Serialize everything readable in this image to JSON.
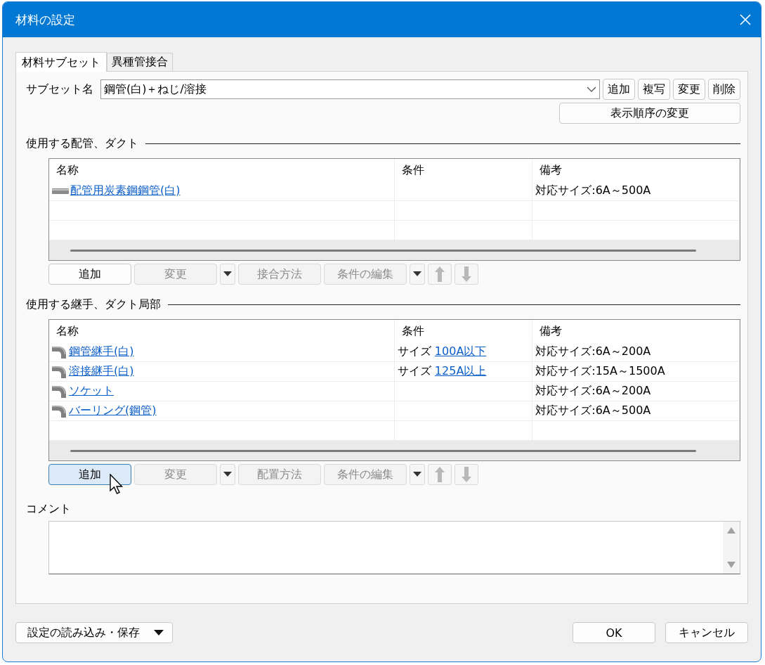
{
  "window": {
    "title": "材料の設定"
  },
  "tabs": [
    {
      "label": "材料サブセット",
      "selected": true
    },
    {
      "label": "異種管接合",
      "selected": false
    }
  ],
  "subset": {
    "label": "サブセット名",
    "value": "鋼管(白)＋ねじ/溶接",
    "buttons": [
      "追加",
      "複写",
      "変更",
      "削除"
    ],
    "order_button": "表示順序の変更"
  },
  "sections": [
    {
      "title": "使用する配管、ダクト",
      "columns": [
        "名称",
        "条件",
        "備考"
      ],
      "rows": [
        {
          "kind": "pipe",
          "name": "配管用炭素鋼鋼管(白)",
          "note": "対応サイズ:6A～500A"
        }
      ],
      "toolbar": [
        {
          "kind": "button",
          "label": "追加",
          "disabled": false,
          "hovered": false
        },
        {
          "kind": "button",
          "label": "変更",
          "disabled": true,
          "hovered": false
        },
        {
          "kind": "caret",
          "disabled": false
        },
        {
          "kind": "button",
          "label": "接合方法",
          "disabled": true,
          "hovered": false
        },
        {
          "kind": "button",
          "label": "条件の編集",
          "disabled": true,
          "hovered": false
        },
        {
          "kind": "caret",
          "disabled": false
        },
        {
          "kind": "up",
          "disabled": true
        },
        {
          "kind": "down",
          "disabled": true
        }
      ]
    },
    {
      "title": "使用する継手、ダクト局部",
      "columns": [
        "名称",
        "条件",
        "備考"
      ],
      "rows": [
        {
          "kind": "elbow",
          "name": "鋼管継手(白)",
          "condition_label": "サイズ",
          "condition_value": "100A以下",
          "note": "対応サイズ:6A～200A"
        },
        {
          "kind": "elbow",
          "name": "溶接継手(白)",
          "condition_label": "サイズ",
          "condition_value": "125A以上",
          "note": "対応サイズ:15A～1500A"
        },
        {
          "kind": "elbow",
          "name": "ソケット",
          "note": "対応サイズ:6A～200A"
        },
        {
          "kind": "elbow",
          "name": "バーリング(鋼管)",
          "note": "対応サイズ:6A～500A"
        }
      ],
      "toolbar": [
        {
          "kind": "button",
          "label": "追加",
          "disabled": false,
          "hovered": true
        },
        {
          "kind": "button",
          "label": "変更",
          "disabled": true,
          "hovered": false
        },
        {
          "kind": "caret",
          "disabled": false
        },
        {
          "kind": "button",
          "label": "配置方法",
          "disabled": true,
          "hovered": false
        },
        {
          "kind": "button",
          "label": "条件の編集",
          "disabled": true,
          "hovered": false
        },
        {
          "kind": "caret",
          "disabled": false
        },
        {
          "kind": "up",
          "disabled": true
        },
        {
          "kind": "down",
          "disabled": true
        }
      ]
    }
  ],
  "comment": {
    "label": "コメント"
  },
  "footer": {
    "menu_button": "設定の読み込み・保存",
    "ok": "OK",
    "cancel": "キャンセル"
  }
}
